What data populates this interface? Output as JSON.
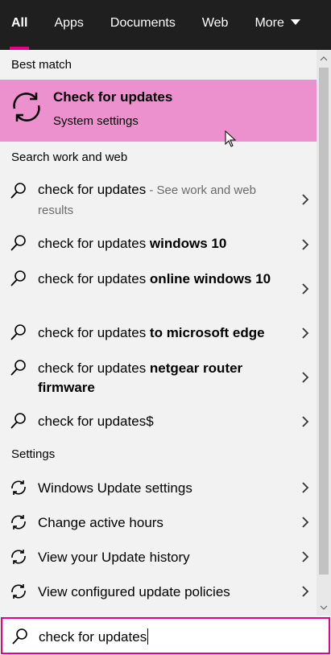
{
  "tabs": [
    {
      "label": "All",
      "active": true
    },
    {
      "label": "Apps"
    },
    {
      "label": "Documents"
    },
    {
      "label": "Web"
    },
    {
      "label": "More",
      "dropdown": true
    }
  ],
  "sections": {
    "best_match": "Best match",
    "search_web": "Search work and web",
    "settings": "Settings"
  },
  "best_match": {
    "title": "Check for updates",
    "subtitle": "System settings",
    "icon": "refresh-icon"
  },
  "web_results": [
    {
      "query": "check for updates",
      "hint": " - See work and web results",
      "bold": ""
    },
    {
      "query": "check for updates ",
      "bold": "windows 10"
    },
    {
      "query": "check for updates ",
      "bold": "online windows 10"
    },
    {
      "query": "check for updates ",
      "bold": "to microsoft edge"
    },
    {
      "query": "check for updates ",
      "bold": "netgear router firmware"
    },
    {
      "query": "check for updates$",
      "bold": ""
    }
  ],
  "settings_results": [
    {
      "label": "Windows Update settings"
    },
    {
      "label": "Change active hours"
    },
    {
      "label": "View your Update history"
    },
    {
      "label": "View configured update policies"
    }
  ],
  "search": {
    "value": "check for updates"
  },
  "colors": {
    "accent": "#e3008c",
    "highlight": "#ec91cd",
    "tabbar": "#1f1f1f",
    "background": "#f2f2f2"
  }
}
